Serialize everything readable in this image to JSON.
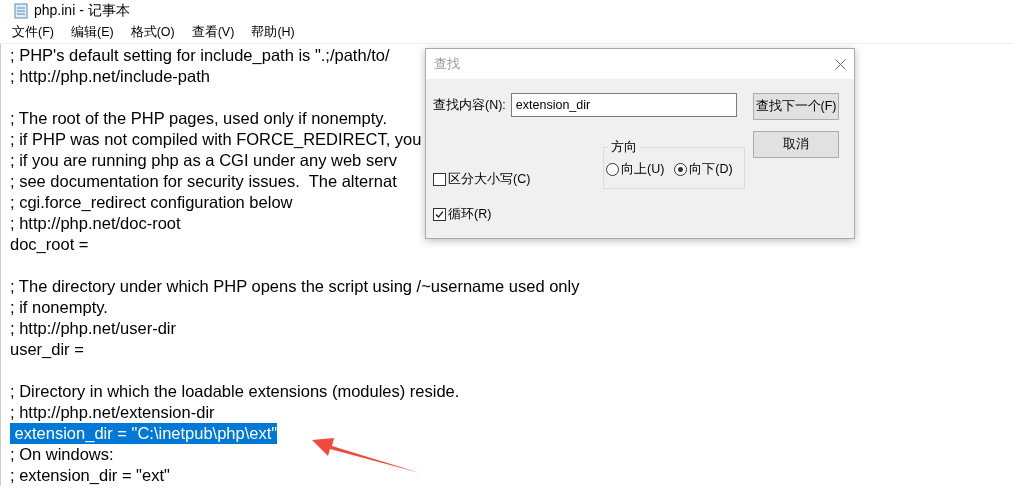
{
  "window": {
    "title": "php.ini - 记事本"
  },
  "menu": [
    "文件(F)",
    "编辑(E)",
    "格式(O)",
    "查看(V)",
    "帮助(H)"
  ],
  "editor": {
    "blocks": [
      [
        {
          "text": "; PHP's default setting for include_path is \".;/path/to/",
          "selected": false
        },
        {
          "text": "; http://php.net/include-path",
          "selected": false
        }
      ],
      [
        {
          "text": "; The root of the PHP pages, used only if nonempty.",
          "selected": false
        },
        {
          "text": "; if PHP was not compiled with FORCE_REDIRECT, you",
          "selected": false
        },
        {
          "text": "; if you are running php as a CGI under any web serv",
          "selected": false
        },
        {
          "text": "; see documentation for security issues.  The alternat",
          "selected": false
        },
        {
          "text": "; cgi.force_redirect configuration below",
          "selected": false
        },
        {
          "text": "; http://php.net/doc-root",
          "selected": false
        },
        {
          "text": "doc_root =",
          "selected": false
        }
      ],
      [
        {
          "text": "; The directory under which PHP opens the script using /~username used only",
          "selected": false
        },
        {
          "text": "; if nonempty.",
          "selected": false
        },
        {
          "text": "; http://php.net/user-dir",
          "selected": false
        },
        {
          "text": "user_dir =",
          "selected": false
        }
      ],
      [
        {
          "text": "; Directory in which the loadable extensions (modules) reside.",
          "selected": false
        },
        {
          "text": "; http://php.net/extension-dir",
          "selected": false
        },
        {
          "text": " extension_dir = \"C:\\inetpub\\php\\ext\"",
          "selected": true
        },
        {
          "text": "; On windows:",
          "selected": false
        },
        {
          "text": "; extension_dir = \"ext\"",
          "selected": false
        }
      ]
    ]
  },
  "find_dialog": {
    "title": "查找",
    "find_label": "查找内容(N):",
    "find_value": "extension_dir",
    "buttons": [
      "查找下一个(F)",
      "取消"
    ],
    "direction": {
      "legend": "方向",
      "options": [
        {
          "label": "向上(U)",
          "selected": false
        },
        {
          "label": "向下(D)",
          "selected": true
        }
      ]
    },
    "checkboxes": [
      {
        "label": "区分大小写(C)",
        "checked": false
      },
      {
        "label": "循环(R)",
        "checked": true
      }
    ]
  }
}
